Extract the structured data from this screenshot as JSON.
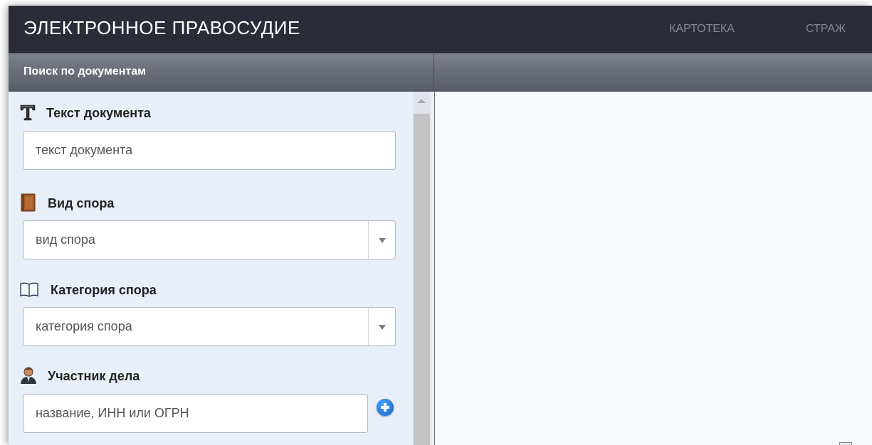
{
  "header": {
    "brand": "ЭЛЕКТРОННОЕ ПРАВОСУДИЕ",
    "nav": [
      {
        "label": "КАРТОТЕКА"
      },
      {
        "label": "СТРАЖ"
      }
    ]
  },
  "panel": {
    "title": "Поиск по документам"
  },
  "form": {
    "document_text": {
      "label": "Текст документа",
      "icon": "text-t-icon",
      "placeholder": "текст документа"
    },
    "dispute_type": {
      "label": "Вид спора",
      "icon": "book-icon",
      "placeholder": "вид спора"
    },
    "dispute_category": {
      "label": "Категория спора",
      "icon": "open-book-icon",
      "placeholder": "категория спора"
    },
    "case_participant": {
      "label": "Участник дела",
      "icon": "person-icon",
      "placeholder": "название, ИНН или ОГРН"
    }
  },
  "colors": {
    "topbar": "#2a2c38",
    "sidebar": "#e9eff9",
    "accent_blue": "#1a73d8"
  }
}
